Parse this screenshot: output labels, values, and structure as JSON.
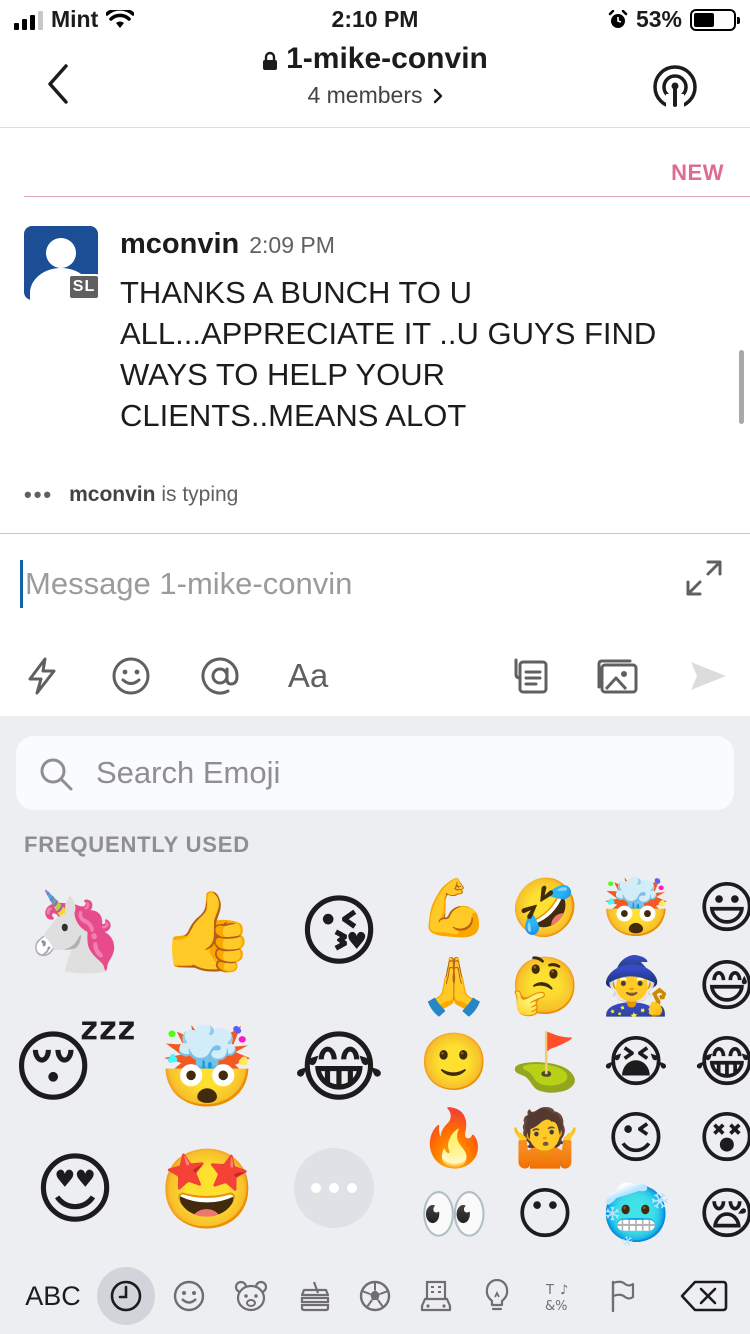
{
  "status_bar": {
    "carrier": "Mint",
    "time": "2:10 PM",
    "battery": "53%"
  },
  "header": {
    "channel_name": "1-mike-convin",
    "members": "4 members"
  },
  "divider": {
    "label": "NEW"
  },
  "message": {
    "author": "mconvin",
    "time": "2:09 PM",
    "badge": "SL",
    "text": "THANKS A BUNCH TO U ALL...APPRECIATE IT ..U GUYS FIND WAYS TO HELP YOUR CLIENTS..MEANS ALOT"
  },
  "typing": {
    "user": "mconvin",
    "suffix": "is typing"
  },
  "composer": {
    "placeholder": "Message 1-mike-convin",
    "format_label": "Aa"
  },
  "emoji_panel": {
    "search_placeholder": "Search Emoji",
    "section_label": "FREQUENTLY USED",
    "memoji": [
      "🦄",
      "👍",
      "😘",
      "😴",
      "🤯",
      "😂",
      "😍",
      "🤩"
    ],
    "emoji_rows": [
      [
        "💪",
        "🤣",
        "🤯",
        "😃"
      ],
      [
        "🙏",
        "🤔",
        "🧙",
        "😅"
      ],
      [
        "🙂",
        "⛳",
        "😭",
        "😂"
      ],
      [
        "🔥",
        "🤷",
        "😉",
        "😵"
      ],
      [
        "👀",
        "😶",
        "🥶",
        "😪"
      ]
    ],
    "tabs": {
      "abc": "ABC"
    }
  },
  "colors": {
    "new_label": "#e06b91",
    "avatar_bg": "#1b4e95",
    "cursor": "#1264a3",
    "keyboard_bg": "#eceef2"
  }
}
